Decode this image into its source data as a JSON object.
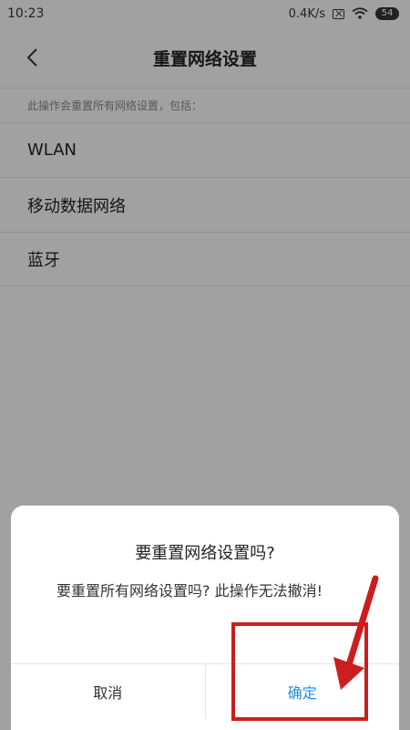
{
  "statusbar": {
    "time": "10:23",
    "speed": "0.4K/s",
    "battery": "54"
  },
  "header": {
    "title": "重置网络设置"
  },
  "description": "此操作会重置所有网络设置，包括：",
  "items": [
    {
      "label": "WLAN"
    },
    {
      "label": "移动数据网络"
    },
    {
      "label": "蓝牙"
    }
  ],
  "dialog": {
    "title": "要重置网络设置吗?",
    "message": "要重置所有网络设置吗? 此操作无法撤消!",
    "cancel_label": "取消",
    "confirm_label": "确定"
  },
  "colors": {
    "accent": "#1e8fe0",
    "annotation": "#cc1e1e"
  }
}
